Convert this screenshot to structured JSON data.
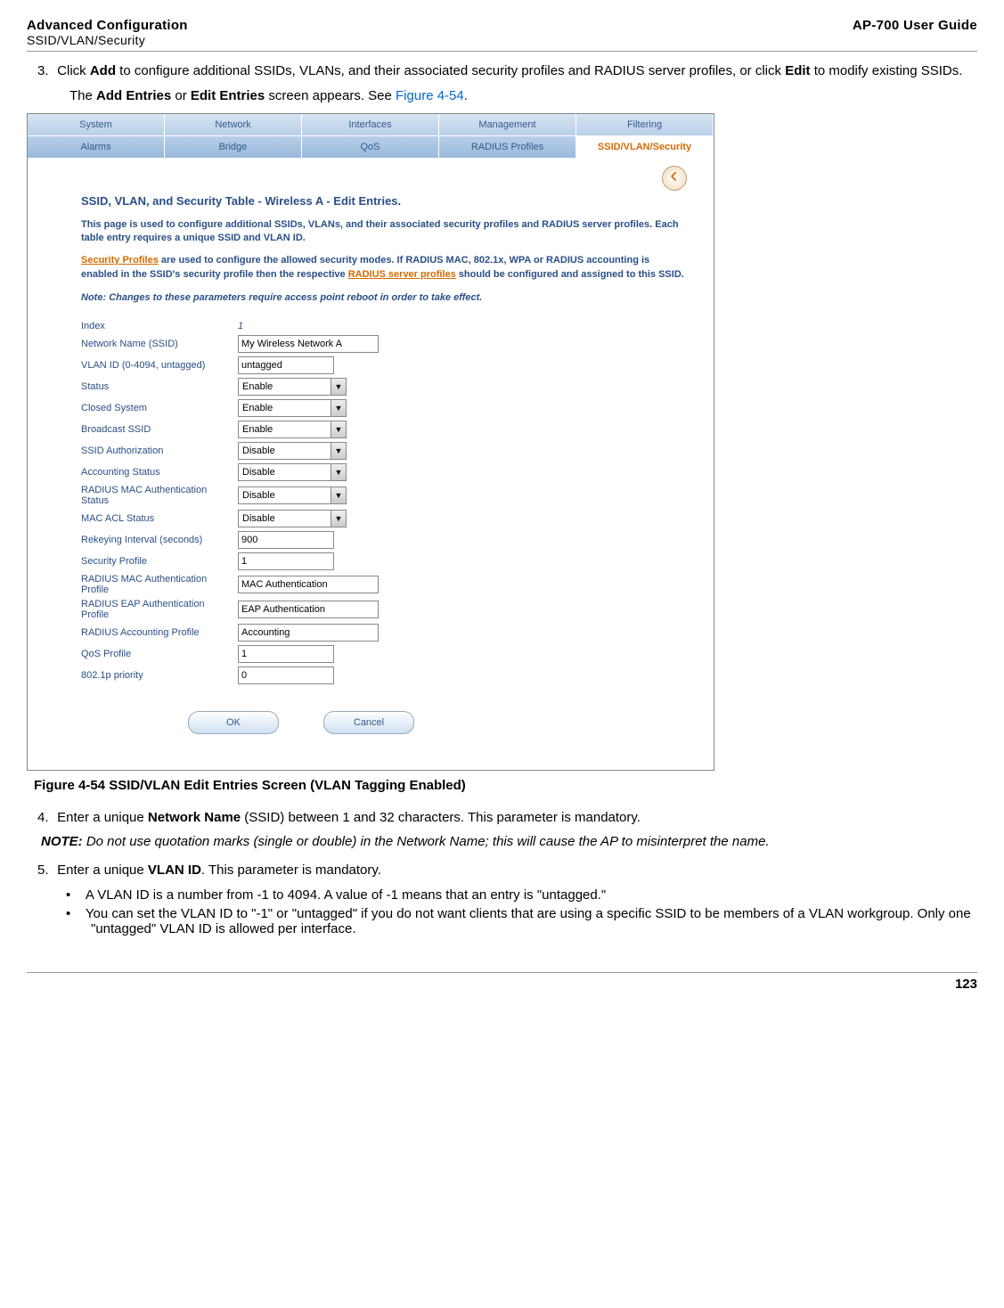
{
  "header": {
    "title_main": "Advanced Configuration",
    "title_sub": "SSID/VLAN/Security",
    "guide": "AP-700 User Guide"
  },
  "step3_a": "Click ",
  "step3_add": "Add",
  "step3_b": " to configure additional SSIDs, VLANs, and their associated security profiles and RADIUS server profiles, or click ",
  "step3_edit": "Edit",
  "step3_c": " to modify existing SSIDs.",
  "step3_line2_a": "The ",
  "step3_line2_b": "Add Entries",
  "step3_line2_c": " or ",
  "step3_line2_d": "Edit Entries",
  "step3_line2_e": " screen appears. See ",
  "step3_line2_link": "Figure 4-54",
  "step3_line2_f": ".",
  "figure_caption": "Figure 4-54 SSID/VLAN Edit Entries Screen (VLAN Tagging Enabled)",
  "step4_a": "Enter a unique ",
  "step4_b": "Network Name",
  "step4_c": " (SSID) between 1 and 32 characters. This parameter is mandatory.",
  "note_label": "NOTE:",
  "note_text": " Do not use quotation marks (single or double) in the Network Name; this will cause the AP to misinterpret the name.",
  "step5_a": "Enter a unique ",
  "step5_b": "VLAN ID",
  "step5_c": ". This parameter is mandatory.",
  "bullet1": "A VLAN ID is a number from -1 to 4094. A value of -1 means that an entry is \"untagged.\"",
  "bullet2": "You can set the VLAN ID to \"-1\" or \"untagged\" if you do not want clients that are using a specific SSID to be members of a VLAN workgroup. Only one \"untagged\" VLAN ID is allowed per interface.",
  "page_number": "123",
  "screenshot": {
    "tabs_row1": [
      "System",
      "Network",
      "Interfaces",
      "Management",
      "Filtering"
    ],
    "tabs_row2": [
      "Alarms",
      "Bridge",
      "QoS",
      "RADIUS Profiles",
      "SSID/VLAN/Security"
    ],
    "panel_title": "SSID, VLAN, and Security Table - Wireless A - Edit Entries.",
    "desc1": "This page is used to configure additional SSIDs, VLANs, and their associated security profiles and RADIUS server profiles. Each table entry requires a unique SSID and VLAN ID.",
    "desc2_a": "Security Profiles",
    "desc2_b": " are used to configure the allowed security modes. If RADIUS MAC, 802.1x, WPA or RADIUS accounting is enabled in the SSID's security profile then the respective ",
    "desc2_c": "RADIUS server profiles",
    "desc2_d": " should be configured and assigned to this SSID.",
    "note": "Note: Changes to these parameters require access point reboot in order to take effect.",
    "fields": {
      "index_label": "Index",
      "index_value": "1",
      "ssid_label": "Network Name (SSID)",
      "ssid_value": "My Wireless Network A",
      "vlan_label": "VLAN ID (0-4094, untagged)",
      "vlan_value": "untagged",
      "status_label": "Status",
      "status_value": "Enable",
      "closed_label": "Closed System",
      "closed_value": "Enable",
      "broadcast_label": "Broadcast SSID",
      "broadcast_value": "Enable",
      "ssidauth_label": "SSID Authorization",
      "ssidauth_value": "Disable",
      "acct_label": "Accounting Status",
      "acct_value": "Disable",
      "radmac_label": "RADIUS MAC Authentication Status",
      "radmac_value": "Disable",
      "macacl_label": "MAC ACL Status",
      "macacl_value": "Disable",
      "rekey_label": "Rekeying Interval (seconds)",
      "rekey_value": "900",
      "secprof_label": "Security Profile",
      "secprof_value": "1",
      "radmacprof_label": "RADIUS MAC Authentication Profile",
      "radmacprof_value": "MAC Authentication",
      "eapprof_label": "RADIUS EAP Authentication Profile",
      "eapprof_value": "EAP Authentication",
      "acctprof_label": "RADIUS Accounting Profile",
      "acctprof_value": "Accounting",
      "qos_label": "QoS Profile",
      "qos_value": "1",
      "priority_label": "802.1p priority",
      "priority_value": "0"
    },
    "ok_label": "OK",
    "cancel_label": "Cancel"
  }
}
